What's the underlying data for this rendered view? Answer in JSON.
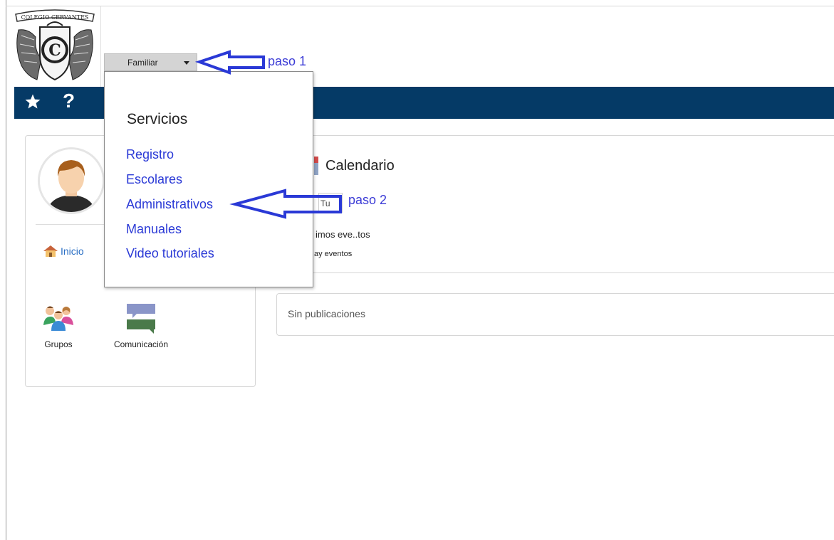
{
  "logo": {
    "text": "COLEGIO CERVANTES"
  },
  "role_select": {
    "selected": "Familiar"
  },
  "annotations": {
    "step1": "paso 1",
    "step2": "paso 2"
  },
  "navbar": {
    "help_symbol": "?",
    "color": "#053a66"
  },
  "menu": {
    "heading": "Servicios",
    "items": [
      {
        "label": "Registro"
      },
      {
        "label": "Escolares"
      },
      {
        "label": "Administrativos"
      },
      {
        "label": "Manuales"
      },
      {
        "label": "Video tutoriales"
      }
    ]
  },
  "sidebar": {
    "home_label": "Inicio",
    "apps": [
      {
        "label": "Grupos",
        "icon": "users-icon"
      },
      {
        "label": "Comunicación",
        "icon": "chat-icon"
      }
    ]
  },
  "calendar": {
    "title": "Calendario",
    "input_value": "Tu",
    "events_heading": "imos eve..tos",
    "no_events": "ay eventos"
  },
  "posts": {
    "empty_text": "Sin publicaciones"
  },
  "colors": {
    "accent": "#053a66",
    "annotation": "#3c3cd6",
    "link": "#2a39d6"
  }
}
